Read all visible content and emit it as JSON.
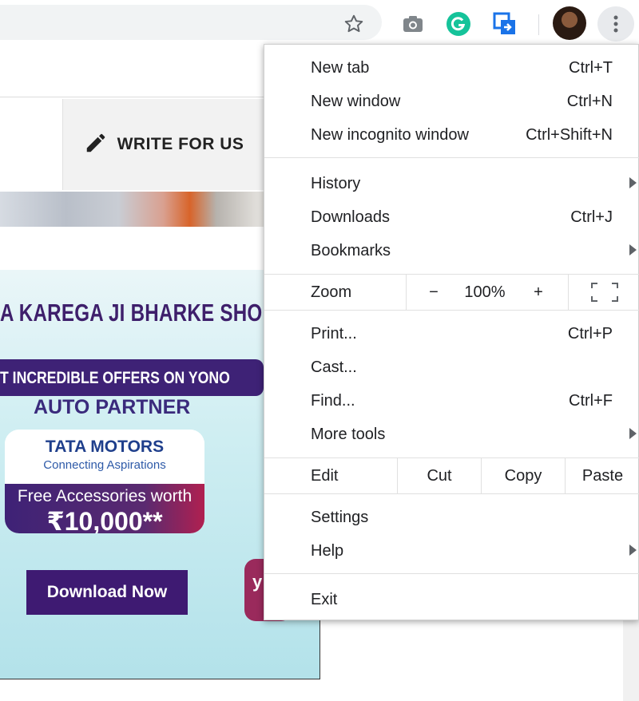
{
  "toolbar": {
    "icons": [
      "star-icon",
      "camera-icon",
      "grammarly-icon",
      "extension-icon",
      "avatar",
      "more-vert-icon"
    ]
  },
  "page": {
    "write_for_us": "WRITE FOR US",
    "ad": {
      "title": "A KAREGA JI BHARKE SHOPPI",
      "offer": "T INCREDIBLE OFFERS ON YONO",
      "partner": "AUTO PARTNER",
      "brand": "TATA MOTORS",
      "tagline": "Connecting Aspirations",
      "free_text": "Free Accessories worth",
      "price": "₹10,000**",
      "cta": "Download Now",
      "corner": "y"
    }
  },
  "menu": {
    "group1": [
      {
        "label": "New tab",
        "shortcut": "Ctrl+T"
      },
      {
        "label": "New window",
        "shortcut": "Ctrl+N"
      },
      {
        "label": "New incognito window",
        "shortcut": "Ctrl+Shift+N"
      }
    ],
    "group2": [
      {
        "label": "History",
        "shortcut": ""
      },
      {
        "label": "Downloads",
        "shortcut": "Ctrl+J"
      },
      {
        "label": "Bookmarks",
        "shortcut": ""
      }
    ],
    "zoom": {
      "label": "Zoom",
      "minus": "−",
      "value": "100%",
      "plus": "+"
    },
    "group3": [
      {
        "label": "Print...",
        "shortcut": "Ctrl+P"
      },
      {
        "label": "Cast...",
        "shortcut": ""
      },
      {
        "label": "Find...",
        "shortcut": "Ctrl+F"
      },
      {
        "label": "More tools",
        "shortcut": ""
      }
    ],
    "edit": {
      "label": "Edit",
      "cut": "Cut",
      "copy": "Copy",
      "paste": "Paste"
    },
    "group4": [
      {
        "label": "Settings"
      },
      {
        "label": "Help"
      }
    ],
    "exit": "Exit"
  }
}
